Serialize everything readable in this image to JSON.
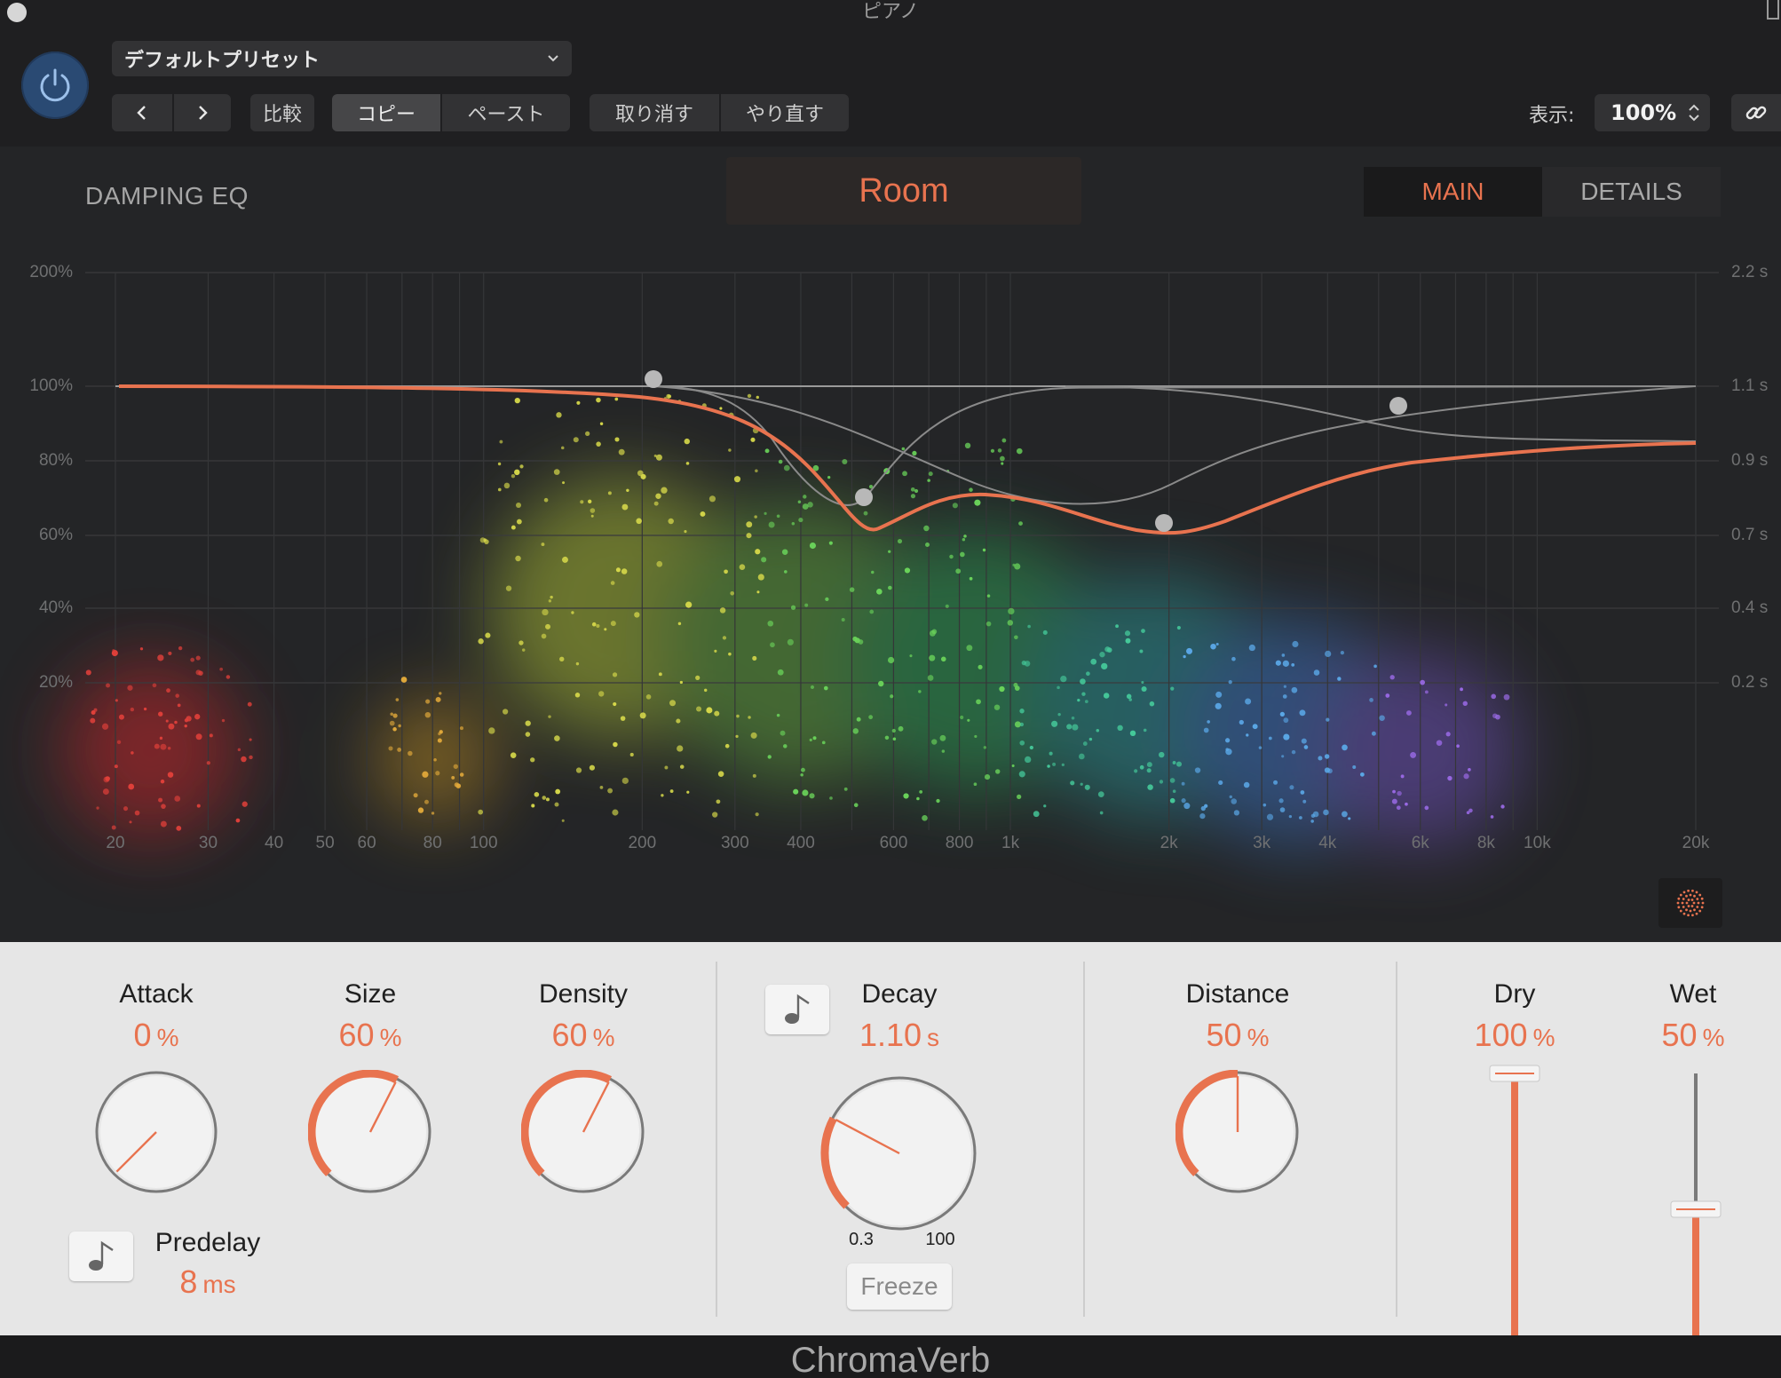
{
  "window": {
    "title": "ピアノ"
  },
  "toolbar": {
    "preset": "デフォルトプリセット",
    "compare": "比較",
    "copy": "コピー",
    "paste": "ペースト",
    "undo": "取り消す",
    "redo": "やり直す",
    "view_label": "表示:",
    "zoom": "100%"
  },
  "eq": {
    "title": "DAMPING EQ",
    "room_type": "Room",
    "tabs": [
      "MAIN",
      "DETAILS"
    ],
    "active_tab": "MAIN",
    "y_left_ticks": [
      "200%",
      "100%",
      "80%",
      "60%",
      "40%",
      "20%"
    ],
    "y_right_ticks": [
      "2.2 s",
      "1.1 s",
      "0.9 s",
      "0.7 s",
      "0.4 s",
      "0.2 s"
    ],
    "x_ticks": [
      "20",
      "30",
      "40",
      "50",
      "60",
      "80",
      "100",
      "200",
      "300",
      "400",
      "600",
      "800",
      "1k",
      "2k",
      "3k",
      "4k",
      "6k",
      "8k",
      "10k",
      "20k"
    ],
    "colors": {
      "curve": "#e8734f",
      "bands": "#8a8a8a"
    }
  },
  "controls": {
    "attack": {
      "label": "Attack",
      "value": "0",
      "unit": "%",
      "level": 0.0
    },
    "size": {
      "label": "Size",
      "value": "60",
      "unit": "%",
      "level": 0.6
    },
    "density": {
      "label": "Density",
      "value": "60",
      "unit": "%",
      "level": 0.6
    },
    "predelay": {
      "label": "Predelay",
      "value": "8",
      "unit": "ms"
    },
    "decay": {
      "label": "Decay",
      "value": "1.10",
      "unit": "s",
      "level": 0.27,
      "min": "0.3",
      "max": "100",
      "freeze": "Freeze"
    },
    "distance": {
      "label": "Distance",
      "value": "50",
      "unit": "%",
      "level": 0.5
    },
    "dry": {
      "label": "Dry",
      "value": "100",
      "unit": "%",
      "level": 1.0
    },
    "wet": {
      "label": "Wet",
      "value": "50",
      "unit": "%",
      "level": 0.5
    }
  },
  "footer": {
    "plugin_name": "ChromaVerb"
  },
  "accent": "#e8734f"
}
